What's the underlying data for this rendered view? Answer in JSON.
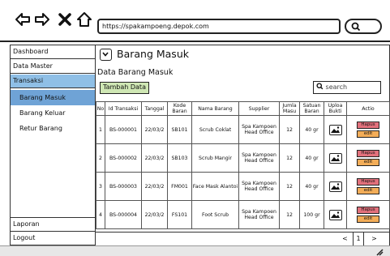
{
  "browser": {
    "url": "https://spakampoeng.depok.com",
    "icons": [
      "arrow-left-icon",
      "arrow-right-icon",
      "close-icon",
      "home-icon",
      "search-icon"
    ]
  },
  "sidebar": {
    "items": [
      {
        "label": "Dashboard"
      },
      {
        "label": "Data Master"
      },
      {
        "label": "Transaksi"
      },
      {
        "label": "Laporan"
      },
      {
        "label": "Logout"
      }
    ],
    "sub_items": [
      {
        "label": "Barang Masuk",
        "active": true
      },
      {
        "label": "Barang Keluar"
      },
      {
        "label": "Retur Barang"
      }
    ]
  },
  "main": {
    "title": "Barang Masuk",
    "section_label": "Data Barang Masuk",
    "add_button": "Tambah Data",
    "search_placeholder": "search"
  },
  "table": {
    "columns": [
      "No",
      "Id Transaksi",
      "Tanggal",
      "Kode Baran",
      "Nama Barang",
      "Supplier",
      "Jumla Masu",
      "Satuan Baran",
      "Uploa Bukti",
      "Actio"
    ],
    "rows": [
      {
        "no": "1",
        "id": "BS-000001",
        "tanggal": "22/03/2",
        "kode": "SB101",
        "nama": "Scrub Coklat",
        "supplier": "Spa Kampoen Head Office",
        "jumlah": "12",
        "satuan": "40 gr"
      },
      {
        "no": "2",
        "id": "BS-000002",
        "tanggal": "22/03/2",
        "kode": "SB103",
        "nama": "Scrub Mangir",
        "supplier": "Spa Kampoen Head Office",
        "jumlah": "12",
        "satuan": "40 gr"
      },
      {
        "no": "3",
        "id": "BS-000003",
        "tanggal": "22/03/2",
        "kode": "FM001",
        "nama": "Face Mask Alantoi",
        "supplier": "Spa Kampoen Head Office",
        "jumlah": "12",
        "satuan": "40 gr"
      },
      {
        "no": "4",
        "id": "BS-000004",
        "tanggal": "22/03/2",
        "kode": "FS101",
        "nama": "Foot Scrub",
        "supplier": "Spa Kampoen Head Office",
        "jumlah": "12",
        "satuan": "100 gr"
      }
    ],
    "action_delete": "Hapus",
    "action_edit": "edit"
  },
  "pagination": {
    "prev": "<",
    "page": "1",
    "next": ">"
  },
  "colors": {
    "active_parent": "#8fbfe6",
    "active_sub": "#6fa3d6",
    "add_button": "#cfe7b4",
    "delete": "#e2717c",
    "edit": "#f3ad58"
  }
}
